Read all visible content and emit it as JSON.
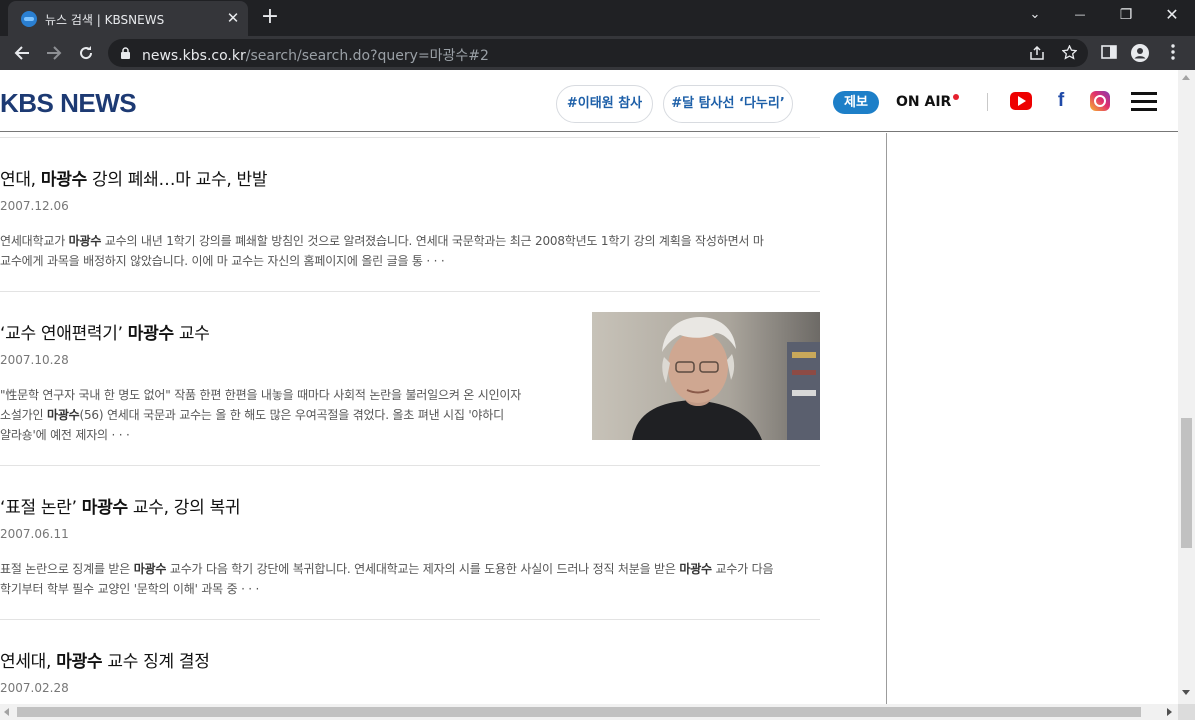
{
  "browser": {
    "tab_title": "뉴스 검색 | KBSNEWS",
    "tab_close": "✕",
    "new_tab": "+",
    "url_host": "news.kbs.co.kr",
    "url_path": "/search/search.do?query=마광수#2",
    "window_controls": {
      "dropdown": "⌄",
      "minimize": "—",
      "restore": "❐",
      "close": "✕"
    }
  },
  "site": {
    "logo_text": "KBS NEWS",
    "hashtags": [
      "#이태원 참사",
      "#달 탐사선 ‘다누리’"
    ],
    "jebo_label": "제보",
    "onair_label": "ON AIR",
    "social_icons": [
      "youtube-icon",
      "facebook-icon",
      "instagram-icon"
    ],
    "facebook_glyph": "f",
    "brand_color": "#1d3a73",
    "accent_color": "#1d7fc8"
  },
  "articles": [
    {
      "title_pre": "연대, ",
      "title_bold": "마광수",
      "title_post": " 강의 폐쇄…마 교수, 반발",
      "date": "2007.12.06",
      "summary_line1_pre": "연세대학교가 ",
      "summary_line1_bold": "마광수",
      "summary_line1_post": " 교수의 내년 1학기 강의를 폐쇄할 방침인 것으로 알려졌습니다. 연세대 국문학과는 최근 2008학년도 1학기 강의 계획을 작성하면서 마",
      "summary_line2": "교수에게 과목을 배정하지 않았습니다. 이에 마 교수는 자신의 홈페이지에 올린 글을 통 · · ·"
    },
    {
      "title_pre": "‘교수 연애편력기’ ",
      "title_bold": "마광수",
      "title_post": " 교수",
      "date": "2007.10.28",
      "summary_line1": "\"性문학 연구자 국내 한 명도 없어\" 작품 한편 한편을 내놓을 때마다 사회적 논란을 불러일으켜 온 시인이자",
      "summary_line2_pre": "소설가인 ",
      "summary_line2_bold": "마광수",
      "summary_line2_post": "(56) 연세대 국문과 교수는 올 한 해도 많은 우여곡절을 겪었다. 올초 펴낸 시집 '야하디",
      "summary_line3": "얄라숑'에 예전 제자의 · · ·"
    },
    {
      "title_pre": "‘표절 논란’ ",
      "title_bold": "마광수",
      "title_post": " 교수, 강의 복귀",
      "date": "2007.06.11",
      "summary_line1_pre": "표절 논란으로 징계를 받은 ",
      "summary_line1_bold": "마광수",
      "summary_line1_mid": " 교수가 다음 학기 강단에 복귀합니다. 연세대학교는 제자의 시를 도용한 사실이 드러나 정직 처분을 받은 ",
      "summary_line1_bold2": "마광수",
      "summary_line1_post": " 교수가 다음",
      "summary_line2": "학기부터 학부 필수 교양인 '문학의 이해' 과목 중 · · ·"
    },
    {
      "title_pre": "연세대, ",
      "title_bold": "마광수",
      "title_post": " 교수 징계 결정",
      "date": "2007.02.28"
    }
  ]
}
